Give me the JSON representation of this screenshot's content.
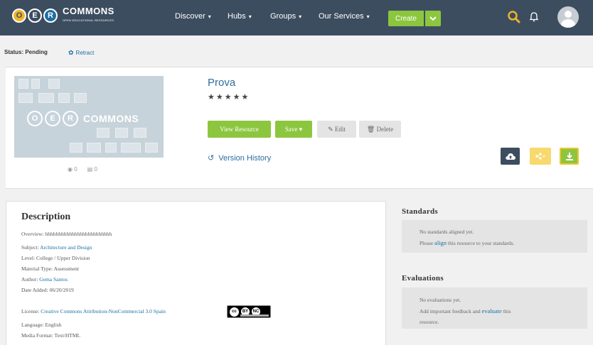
{
  "nav": {
    "logo_text": "COMMONS",
    "logo_sub": "OPEN EDUCATIONAL RESOURCES",
    "logo_letters": [
      "O",
      "E",
      "R"
    ],
    "items": [
      "Discover",
      "Hubs",
      "Groups",
      "Our Services"
    ],
    "create_label": "Create"
  },
  "status": {
    "label": "Status: Pending",
    "retract": "Retract"
  },
  "resource": {
    "title": "Prova",
    "stars": "★★★★★",
    "views": "0",
    "saves": "0",
    "buttons": {
      "view": "View Resource",
      "save": "Save",
      "edit": "Edit",
      "delete": "Delete"
    },
    "version_history": "Version History"
  },
  "description": {
    "heading": "Description",
    "overview_label": "Overview:",
    "overview": "hhhhhhhhhhhhhhhhhhhhhhhhh",
    "subject_label": "Subject:",
    "subject": "Architecture and Design",
    "level_label": "Level:",
    "level": "College / Upper Division",
    "material_label": "Material Type:",
    "material": "Assessment",
    "author_label": "Author:",
    "author": "Gema Santos",
    "date_label": "Date Added:",
    "date": "06/20/2019",
    "license_label": "License:",
    "license": "Creative Commons Attribution-NonCommercial 3.0 Spain",
    "cc_icons": [
      "cc",
      "BY",
      "NC"
    ],
    "language_label": "Language:",
    "language": "English",
    "media_label": "Media Format:",
    "media": "Text/HTML"
  },
  "standards": {
    "heading": "Standards",
    "line1": "No standards aligned yet.",
    "line2_pre": "Please",
    "line2_link": "align",
    "line2_post": "this resource to your standards."
  },
  "evaluations": {
    "heading": "Evaluations",
    "line1": "No evaluations yet.",
    "line2_pre": "Add important feedback and",
    "line2_link": "evaluate",
    "line2_post": "this",
    "line3": "resource."
  },
  "colors": {
    "nav_bg": "#3d4d60",
    "accent_green": "#8cc63f",
    "link_blue": "#1c6ea4",
    "search_gold": "#f0b429"
  }
}
